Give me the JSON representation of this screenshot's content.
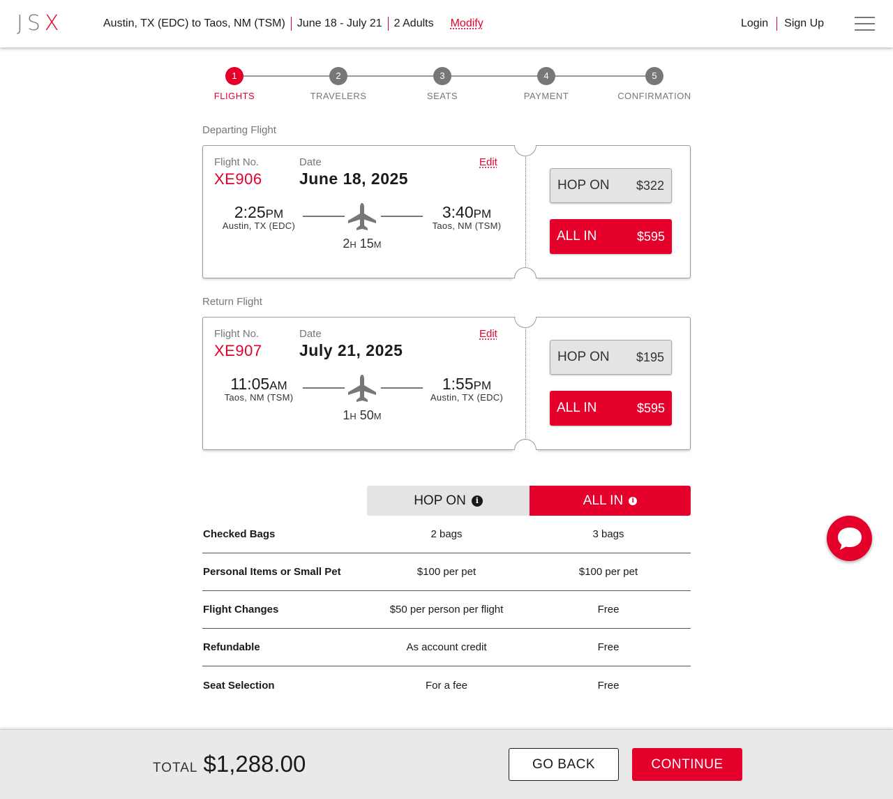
{
  "header": {
    "logo_letters": "JS",
    "logo_x": "X",
    "route": "Austin, TX (EDC) to Taos, NM (TSM)",
    "dates": "June 18 - July 21",
    "passengers": "2 Adults",
    "modify": "Modify",
    "login": "Login",
    "signup": "Sign Up"
  },
  "steps": [
    {
      "num": "1",
      "label": "FLIGHTS",
      "active": true
    },
    {
      "num": "2",
      "label": "TRAVELERS",
      "active": false
    },
    {
      "num": "3",
      "label": "SEATS",
      "active": false
    },
    {
      "num": "4",
      "label": "PAYMENT",
      "active": false
    },
    {
      "num": "5",
      "label": "CONFIRMATION",
      "active": false
    }
  ],
  "departing": {
    "section_label": "Departing Flight",
    "flight_no_label": "Flight No.",
    "flight_no": "XE906",
    "date_label": "Date",
    "date": "June 18, 2025",
    "edit": "Edit",
    "dep_time": "2:25",
    "dep_ampm": "PM",
    "dep_city": "Austin, TX (EDC)",
    "arr_time": "3:40",
    "arr_ampm": "PM",
    "arr_city": "Taos, NM (TSM)",
    "dur_h": "2",
    "dur_h_unit": "H",
    "dur_m": "15",
    "dur_m_unit": "M",
    "hop_on_label": "HOP ON",
    "hop_on_price": "$322",
    "all_in_label": "ALL IN",
    "all_in_price": "$595"
  },
  "return": {
    "section_label": "Return Flight",
    "flight_no_label": "Flight No.",
    "flight_no": "XE907",
    "date_label": "Date",
    "date": "July 21, 2025",
    "edit": "Edit",
    "dep_time": "11:05",
    "dep_ampm": "AM",
    "dep_city": "Taos, NM (TSM)",
    "arr_time": "1:55",
    "arr_ampm": "PM",
    "arr_city": "Austin, TX (EDC)",
    "dur_h": "1",
    "dur_h_unit": "H",
    "dur_m": "50",
    "dur_m_unit": "M",
    "hop_on_label": "HOP ON",
    "hop_on_price": "$195",
    "all_in_label": "ALL IN",
    "all_in_price": "$595"
  },
  "comparison": {
    "hop_on_header": "HOP ON",
    "all_in_header": "ALL IN",
    "info_glyph": "i",
    "rows": [
      {
        "feature": "Checked Bags",
        "hop_on": "2 bags",
        "all_in": "3 bags"
      },
      {
        "feature": "Personal Items or Small Pet",
        "hop_on": "$100 per pet",
        "all_in": "$100 per pet"
      },
      {
        "feature": "Flight Changes",
        "hop_on": "$50 per person per flight",
        "all_in": "Free"
      },
      {
        "feature": "Refundable",
        "hop_on": "As account credit",
        "all_in": "Free"
      },
      {
        "feature": "Seat Selection",
        "hop_on": "For a fee",
        "all_in": "Free"
      }
    ]
  },
  "footer": {
    "total_label": "TOTAL",
    "total_value": "$1,288.00",
    "go_back": "GO BACK",
    "continue": "CONTINUE"
  },
  "icons": {
    "menu": "hamburger-menu-icon",
    "plane": "airplane-icon",
    "info": "info-icon",
    "chat": "chat-bubble-icon"
  },
  "colors": {
    "brand_red": "#e4002b",
    "step_inactive": "#777777",
    "hop_on_bg": "#e4e4e4",
    "footer_bg": "#e9e9e9"
  }
}
